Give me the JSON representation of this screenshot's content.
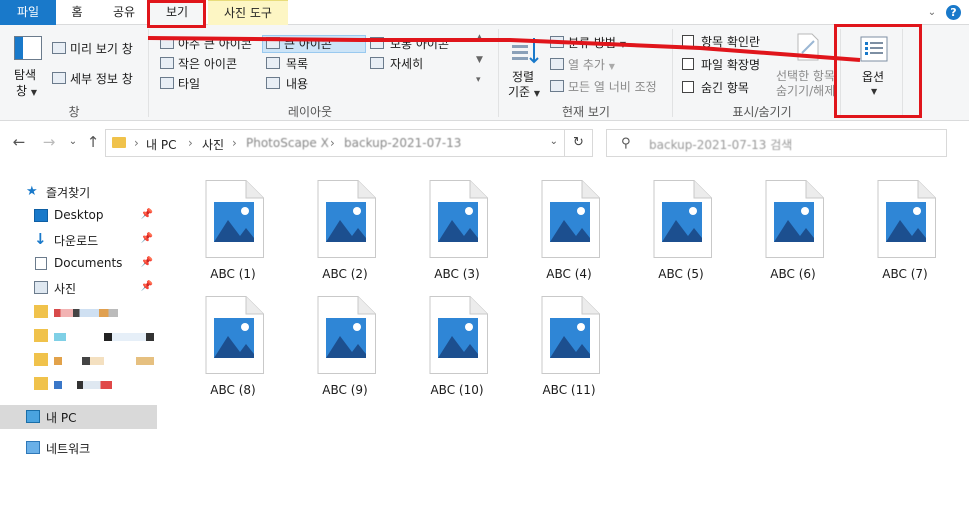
{
  "tabs": {
    "file": "파일",
    "home": "홈",
    "share": "공유",
    "view": "보기",
    "photo_tools": "사진 도구"
  },
  "ribbon": {
    "pane": {
      "nav_pane_label": "탐색\n창",
      "nav_line1": "탐색",
      "nav_line2": "창",
      "preview": "미리 보기 창",
      "details": "세부 정보 창",
      "group_label": "창"
    },
    "layout": {
      "extra_large": "아주 큰 아이콘",
      "large": "큰 아이콘",
      "medium": "보통 아이콘",
      "small": "작은 아이콘",
      "list": "목록",
      "detail": "자세히",
      "tiles": "타일",
      "content": "내용",
      "group_label": "레이아웃",
      "selected": "큰 아이콘"
    },
    "current_view": {
      "sort_line1": "정렬",
      "sort_line2": "기준",
      "group_by": "분류 방법",
      "add_column": "열 추가",
      "fit_columns": "모든 열 너비 조정",
      "group_label": "현재 보기"
    },
    "show_hide": {
      "item_checkbox": "항목 확인란",
      "file_ext": "파일 확장명",
      "hidden_items": "숨긴 항목",
      "hide_selected_line1": "선택한 항목",
      "hide_selected_line2": "숨기기/해제",
      "group_label": "표시/숨기기"
    },
    "options": {
      "label": "옵션"
    }
  },
  "address": {
    "crumbs": [
      "내 PC",
      "사진",
      "PhotoScape X",
      "backup-2021-07-13"
    ],
    "search_placeholder": "backup-2021-07-13 검색"
  },
  "navpane": {
    "quick_access": "즐겨찾기",
    "desktop": "Desktop",
    "downloads": "다운로드",
    "documents": "Documents",
    "pictures": "사진",
    "this_pc": "내 PC",
    "network": "네트워크"
  },
  "files": [
    {
      "name": "ABC (1)"
    },
    {
      "name": "ABC (2)"
    },
    {
      "name": "ABC (3)"
    },
    {
      "name": "ABC (4)"
    },
    {
      "name": "ABC (5)"
    },
    {
      "name": "ABC (6)"
    },
    {
      "name": "ABC (7)"
    },
    {
      "name": "ABC (8)"
    },
    {
      "name": "ABC (9)"
    },
    {
      "name": "ABC (10)"
    },
    {
      "name": "ABC (11)"
    }
  ],
  "colors": {
    "accent": "#1979ca",
    "annotation": "#e0151b",
    "photo_tools_tab": "#fdf6c4",
    "selection": "#cce4f7"
  }
}
